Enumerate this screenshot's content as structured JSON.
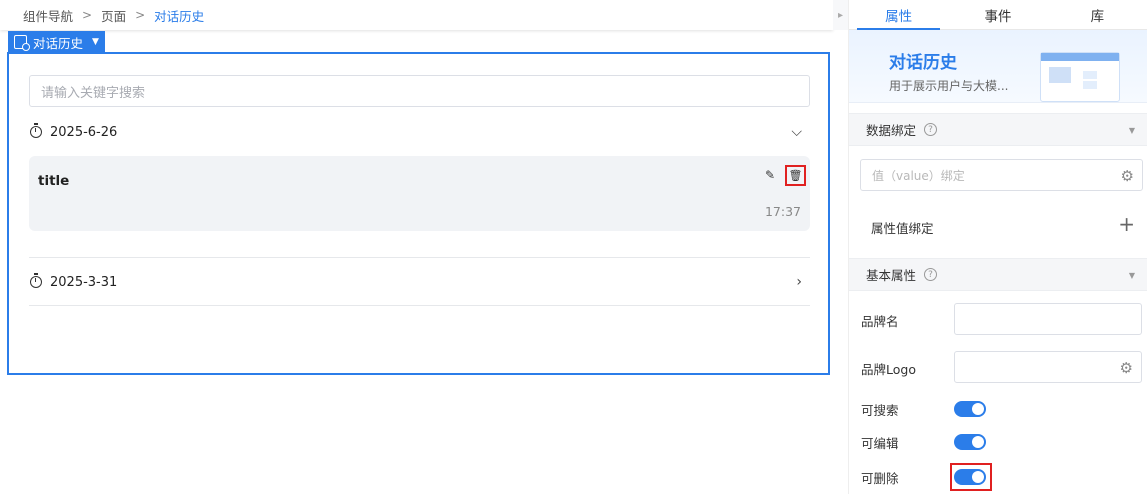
{
  "breadcrumb": {
    "items": [
      "组件导航",
      "页面"
    ],
    "current": "对话历史"
  },
  "collapse_icon": "chevron-right-icon",
  "component_tag": {
    "label": "对话历史",
    "icon": "history-doc-icon"
  },
  "history": {
    "search_placeholder": "请输入关键字搜索",
    "groups": [
      {
        "date": "2025-6-26",
        "expanded": true
      },
      {
        "date": "2025-3-31",
        "expanded": false
      }
    ],
    "item": {
      "title": "title",
      "time": "17:37",
      "edit_icon": "pencil-icon",
      "delete_icon": "trash-icon"
    }
  },
  "panel": {
    "tabs": [
      {
        "label": "属性",
        "active": true
      },
      {
        "label": "事件",
        "active": false
      },
      {
        "label": "库",
        "active": false
      }
    ],
    "banner": {
      "title": "对话历史",
      "desc": "用于展示用户与大模..."
    },
    "data_binding": {
      "title": "数据绑定",
      "value_placeholder": "值（value）绑定",
      "attr_binding_label": "属性值绑定"
    },
    "basic": {
      "title": "基本属性",
      "brand_name_label": "品牌名",
      "brand_logo_label": "品牌Logo",
      "searchable_label": "可搜索",
      "editable_label": "可编辑",
      "deletable_label": "可删除",
      "searchable": true,
      "editable": true,
      "deletable": true
    }
  },
  "colors": {
    "accent": "#2b7de9",
    "highlight": "#e02020"
  }
}
